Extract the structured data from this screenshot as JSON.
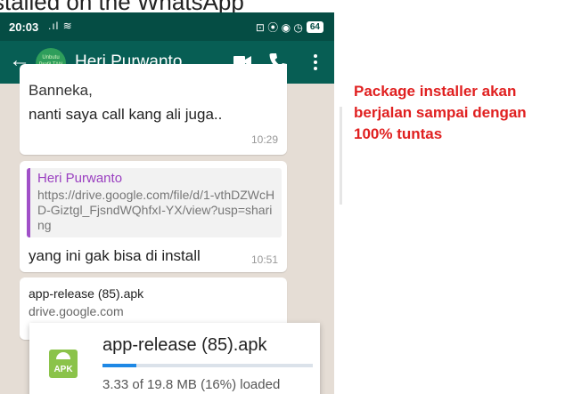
{
  "top_caption": "stalled on the WhatsApp",
  "status_bar": {
    "time": "20:03",
    "signal": ".ıl ≋",
    "icons": "⊡ ⦿ ◉ ◷",
    "battery": "64"
  },
  "app_bar": {
    "contact_name": "Heri Purwanto",
    "avatar_text": "Unbutu Profil TAN BRI"
  },
  "messages": [
    {
      "lines": [
        "Bannekа,",
        "nanti saya call kang ali juga.."
      ],
      "time": "10:29"
    },
    {
      "quote_name": "Heri Purwanto",
      "quote_text": "https://drive.google.com/file/d/1-vthDZWcHD-Giztgl_FjsndWQhfxI-YX/view?usp=sharing",
      "text": "yang ini gak bisa di install",
      "time": "10:51"
    },
    {
      "file_name": "app-release (85).apk",
      "domain": "drive.google.com"
    }
  ],
  "dialog": {
    "icon_label": "APK",
    "title": "app-release (85).apk",
    "status": "3.33 of 19.8 MB (16%) loaded",
    "progress": 0.16,
    "progress_color": "#1e88e5"
  },
  "annotation": "Package installer akan berjalan sampai dengan 100% tuntas",
  "colors": {
    "header": "#075e54",
    "statusbar": "#054d44",
    "chat_bg": "#e5ddd5",
    "annotation": "#e02020"
  }
}
